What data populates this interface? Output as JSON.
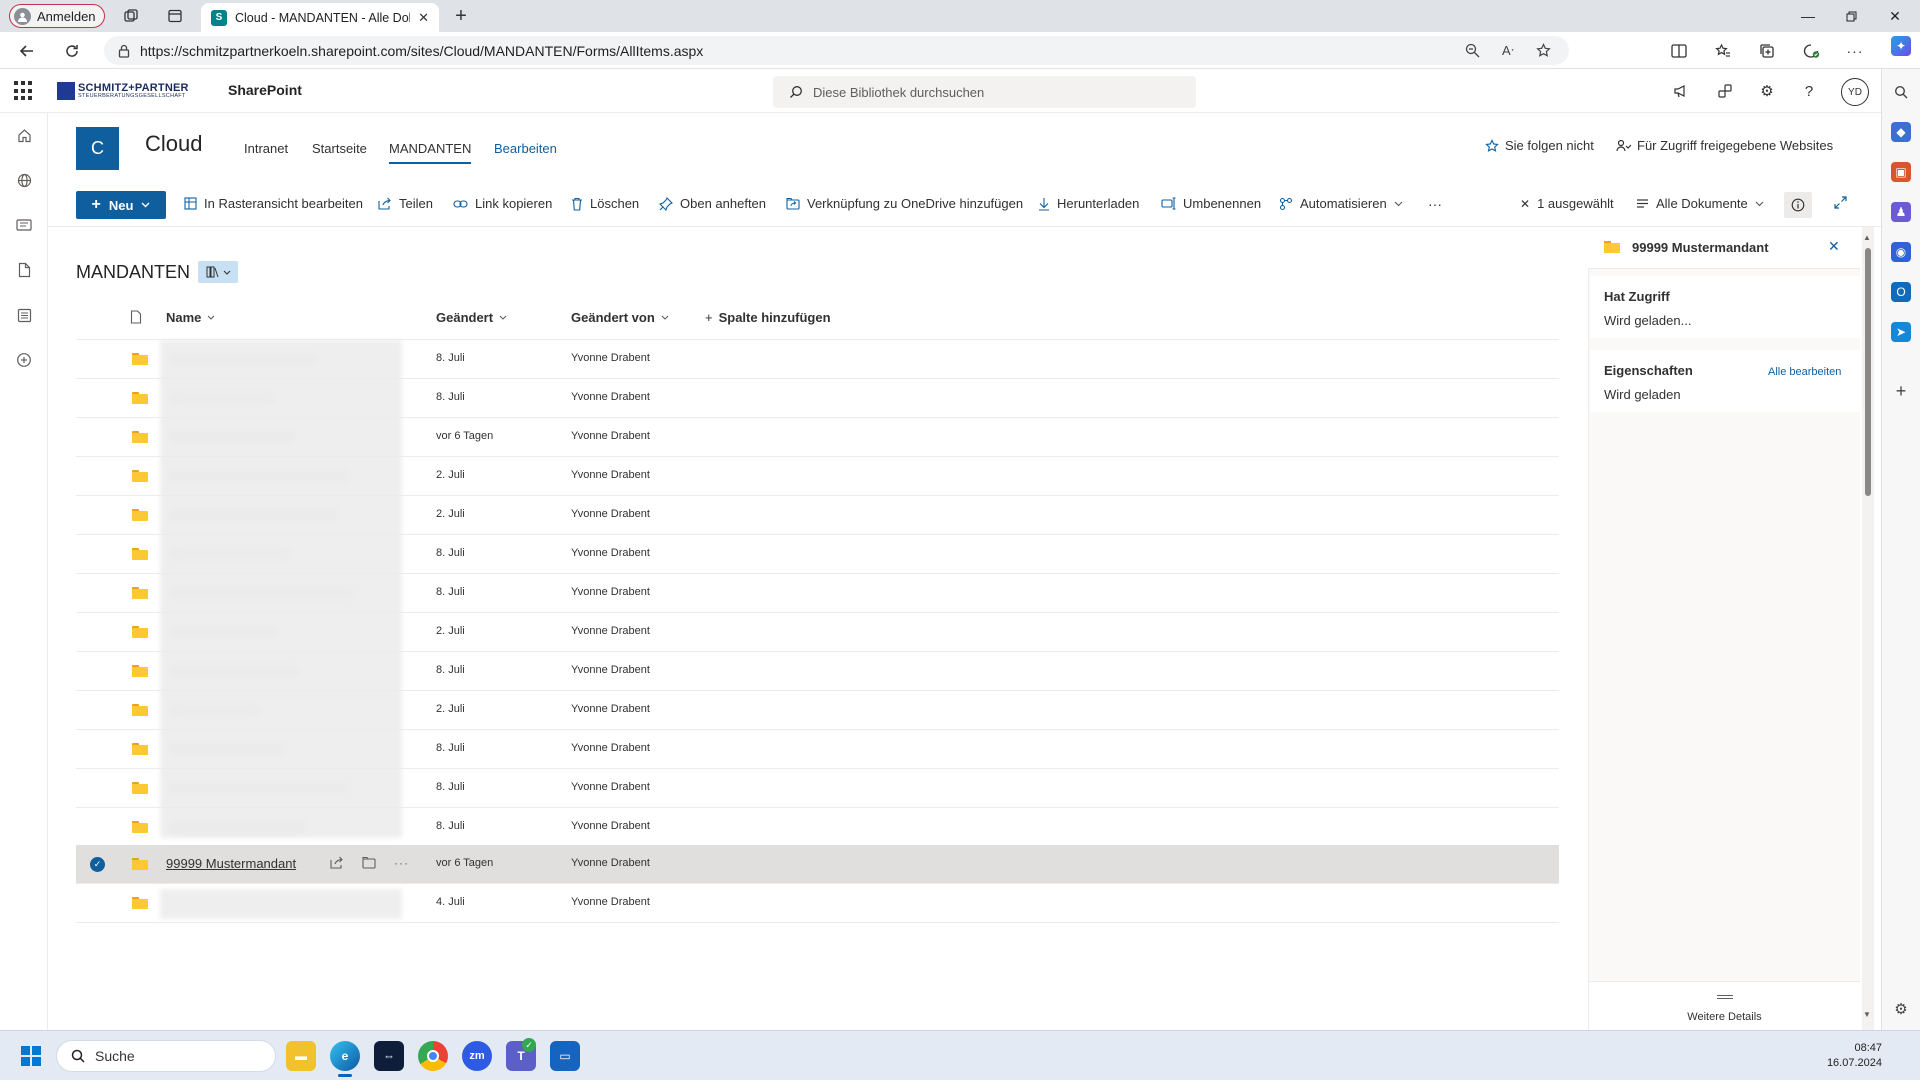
{
  "browser": {
    "profile_label": "Anmelden",
    "tab_title": "Cloud - MANDANTEN - Alle Dok",
    "url": "https://schmitzpartnerkoeln.sharepoint.com/sites/Cloud/MANDANTEN/Forms/AllItems.aspx"
  },
  "suite": {
    "org_name_line1": "SCHMITZ+PARTNER",
    "org_name_line2": "STEUERBERATUNGSGESELLSCHAFT",
    "app_title": "SharePoint",
    "search_placeholder": "Diese Bibliothek durchsuchen",
    "user_initials": "YD"
  },
  "site": {
    "logo_letter": "C",
    "title": "Cloud",
    "nav": [
      "Intranet",
      "Startseite",
      "MANDANTEN",
      "Bearbeiten"
    ],
    "follow_label": "Sie folgen nicht",
    "shared_label": "Für Zugriff freigegebene Websites"
  },
  "commands": {
    "new": "Neu",
    "grid_edit": "In Rasteransicht bearbeiten",
    "share": "Teilen",
    "copy_link": "Link kopieren",
    "delete": "Löschen",
    "pin": "Oben anheften",
    "onedrive_shortcut": "Verknüpfung zu OneDrive hinzufügen",
    "download": "Herunterladen",
    "rename": "Umbenennen",
    "automate": "Automatisieren",
    "more": "···",
    "selected_count": "1 ausgewählt",
    "view_name": "Alle Dokumente"
  },
  "library": {
    "title": "MANDANTEN",
    "columns": {
      "name": "Name",
      "modified": "Geändert",
      "modified_by": "Geändert von",
      "add_column": "Spalte hinzufügen"
    },
    "rows": [
      {
        "modified": "8. Juli",
        "by": "Yvonne Drabent"
      },
      {
        "modified": "8. Juli",
        "by": "Yvonne Drabent"
      },
      {
        "modified": "vor 6 Tagen",
        "by": "Yvonne Drabent"
      },
      {
        "modified": "2. Juli",
        "by": "Yvonne Drabent"
      },
      {
        "modified": "2. Juli",
        "by": "Yvonne Drabent"
      },
      {
        "modified": "8. Juli",
        "by": "Yvonne Drabent"
      },
      {
        "modified": "8. Juli",
        "by": "Yvonne Drabent"
      },
      {
        "modified": "2. Juli",
        "by": "Yvonne Drabent"
      },
      {
        "modified": "8. Juli",
        "by": "Yvonne Drabent"
      },
      {
        "modified": "2. Juli",
        "by": "Yvonne Drabent"
      },
      {
        "modified": "8. Juli",
        "by": "Yvonne Drabent"
      },
      {
        "modified": "8. Juli",
        "by": "Yvonne Drabent"
      },
      {
        "modified": "8. Juli",
        "by": "Yvonne Drabent"
      }
    ],
    "selected_row": {
      "name": "99999 Mustermandant",
      "modified": "vor 6 Tagen",
      "by": "Yvonne Drabent"
    },
    "last_row": {
      "modified": "4. Juli",
      "by": "Yvonne Drabent"
    }
  },
  "details_pane": {
    "title": "99999 Mustermandant",
    "access_heading": "Hat Zugriff",
    "access_value": "Wird geladen...",
    "properties_heading": "Eigenschaften",
    "edit_all": "Alle bearbeiten",
    "properties_value": "Wird geladen",
    "more_details": "Weitere Details"
  },
  "taskbar": {
    "search_label": "Suche",
    "time": "08:47",
    "date": "16.07.2024"
  },
  "colors": {
    "brand": "#0f5f9e",
    "folder": "#fcc934",
    "selected_row": "#e1dfdd"
  }
}
